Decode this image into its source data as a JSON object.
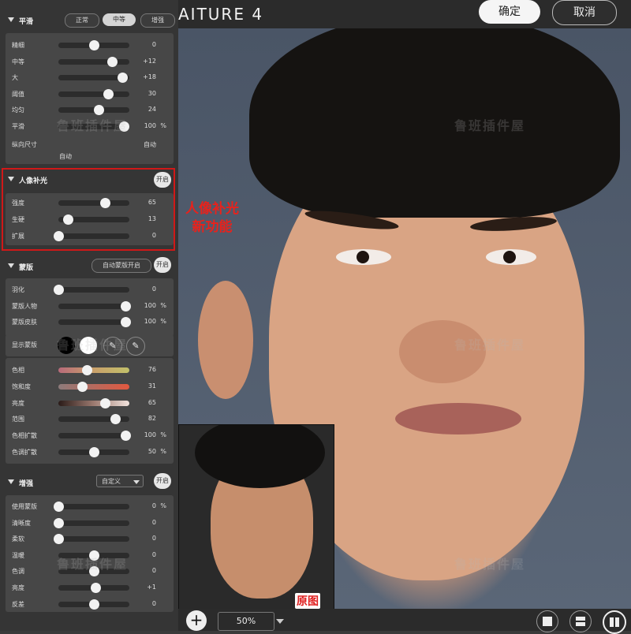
{
  "app": {
    "title": "AITURE 4",
    "confirm_label": "确定",
    "cancel_label": "取消"
  },
  "smooth": {
    "title": "平滑",
    "modes": [
      "正常",
      "中等",
      "增强"
    ],
    "selected_mode": "中等",
    "sliders": [
      {
        "label": "精细",
        "value": "0",
        "unit": "",
        "fraction": 0.5
      },
      {
        "label": "中等",
        "value": "+12",
        "unit": "",
        "fraction": 0.76
      },
      {
        "label": "大",
        "value": "+18",
        "unit": "",
        "fraction": 0.9
      },
      {
        "label": "阈值",
        "value": "30",
        "unit": "",
        "fraction": 0.7
      },
      {
        "label": "均匀",
        "value": "24",
        "unit": "",
        "fraction": 0.57
      },
      {
        "label": "平滑",
        "value": "100",
        "unit": "%",
        "fraction": 0.92
      }
    ],
    "portrait_size_label": "纵向尺寸",
    "portrait_size_value": "自动",
    "portrait_size_value2": "自动"
  },
  "fill_light": {
    "title": "人像补光",
    "toggle": "开启",
    "sliders": [
      {
        "label": "强度",
        "value": "65",
        "unit": "",
        "fraction": 0.65
      },
      {
        "label": "生硬",
        "value": "13",
        "unit": "",
        "fraction": 0.13
      },
      {
        "label": "扩展",
        "value": "0",
        "unit": "",
        "fraction": 0.0
      }
    ]
  },
  "mask": {
    "title": "蒙版",
    "auto_mask": "自动蒙版开启",
    "toggle": "开启",
    "sliders_top": [
      {
        "label": "羽化",
        "value": "0",
        "unit": "",
        "fraction": 0.0
      },
      {
        "label": "蒙版人物",
        "value": "100",
        "unit": "%",
        "fraction": 0.94
      },
      {
        "label": "蒙版皮肤",
        "value": "100",
        "unit": "%",
        "fraction": 0.94
      }
    ],
    "show_mask_label": "显示蒙版",
    "sliders_bottom": [
      {
        "label": "色相",
        "value": "76",
        "unit": "",
        "fraction": 0.4,
        "grad": "hue"
      },
      {
        "label": "饱和度",
        "value": "31",
        "unit": "",
        "fraction": 0.33,
        "grad": "sat"
      },
      {
        "label": "亮度",
        "value": "65",
        "unit": "",
        "fraction": 0.65,
        "grad": "lum"
      },
      {
        "label": "范围",
        "value": "82",
        "unit": "",
        "fraction": 0.8,
        "grad": ""
      },
      {
        "label": "色相扩散",
        "value": "100",
        "unit": "%",
        "fraction": 0.94,
        "grad": ""
      },
      {
        "label": "色调扩散",
        "value": "50",
        "unit": "%",
        "fraction": 0.5,
        "grad": ""
      }
    ]
  },
  "enhance": {
    "title": "增强",
    "preset": "自定义",
    "toggle": "开启",
    "sliders": [
      {
        "label": "使用蒙版",
        "value": "0",
        "unit": "%",
        "fraction": 0.0
      },
      {
        "label": "清晰度",
        "value": "0",
        "unit": "",
        "fraction": 0.0
      },
      {
        "label": "柔软",
        "value": "0",
        "unit": "",
        "fraction": 0.0
      },
      {
        "label": "温暖",
        "value": "0",
        "unit": "",
        "fraction": 0.5
      },
      {
        "label": "色调",
        "value": "0",
        "unit": "",
        "fraction": 0.5
      },
      {
        "label": "亮度",
        "value": "+1",
        "unit": "",
        "fraction": 0.52
      },
      {
        "label": "反差",
        "value": "0",
        "unit": "",
        "fraction": 0.5
      }
    ]
  },
  "annotation": {
    "line1": "人像补光",
    "line2": "新功能"
  },
  "inset_label": "原图",
  "watermark": "鲁班插件屋",
  "bottom": {
    "zoom": "50%",
    "plus": "+"
  },
  "colors": {
    "accent_red": "#e8221c",
    "panel": "#353535",
    "box": "#474747"
  }
}
